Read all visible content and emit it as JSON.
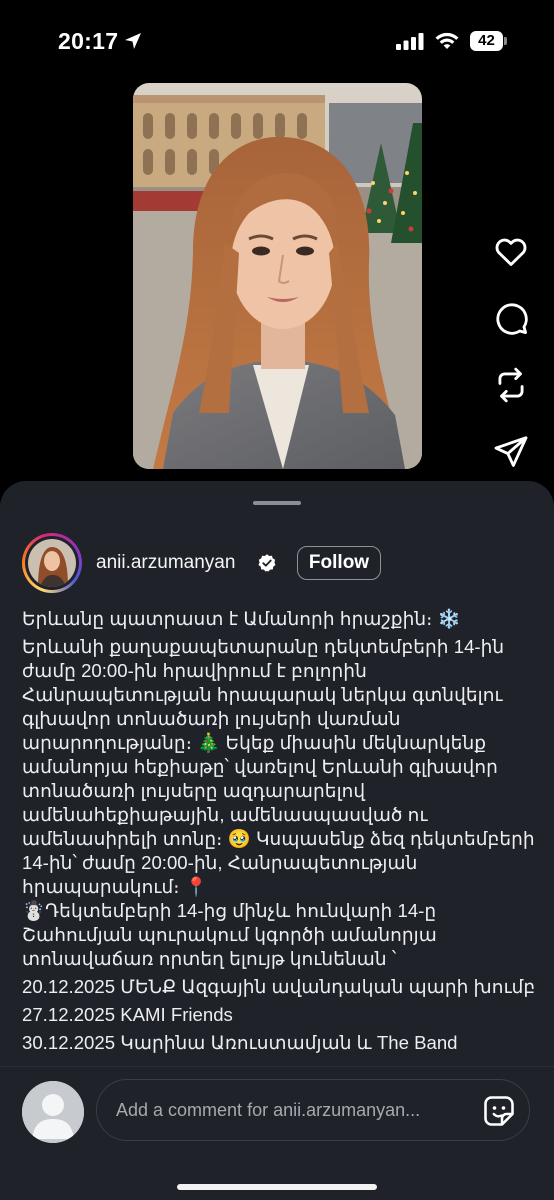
{
  "status_bar": {
    "time": "20:17",
    "battery": "42"
  },
  "post": {
    "username": "anii.arzumanyan",
    "follow_label": "Follow",
    "caption_lines": [
      "Երևանը պատրաստ է Ամանորի հրաշքին։",
      "Երևանի քաղաքապետարանը դեկտեմբերի 14-ին",
      "ժամը 20:00-ին հրավիրում է բոլորին",
      "Հանրապետության հրապարակ ներկա գտնվելու",
      "գլխավոր տոնածառի լույսերի վառման",
      "արարողությանը։",
      "Եկեք միասին մեկնարկենք",
      "ամանորյա հեքիաթը՝ վառելով Երևանի գլխավոր",
      "տոնածառի լույսերը ազդարարելով",
      "ամենահեքիաթային, ամենասպասված ու",
      "ամենասիրելի տոնը։",
      "Կսպասենք ձեզ դեկտեմբերի",
      "14-ին՝ ժամը 20:00-ին, Հանրապետության",
      "հրապարակում։",
      "Դեկտեմբերի 14-ից մինչև հունվարի 14-ը",
      "Շահումյան պուրակում կգործի ամանորյա",
      "տոնավաճառ որտեղ ելույթ կունենան ՝",
      "20.12.2025 ՄԵՆՔ Ազգային ավանդական պարի խումբ",
      "27.12.2025 KAMI Friends",
      "30.12.2025 Կարինա Առուստամյան և The Band"
    ],
    "emojis": {
      "snowflake": "❄️",
      "tree": "🎄",
      "pleading": "🥹",
      "pin": "📍",
      "snowman": "☃️"
    }
  },
  "actions": {
    "like": "heart-icon",
    "comment": "comment-icon",
    "repost": "repost-icon",
    "share": "send-icon"
  },
  "comment_box": {
    "placeholder": "Add a comment for anii.arzumanyan..."
  }
}
